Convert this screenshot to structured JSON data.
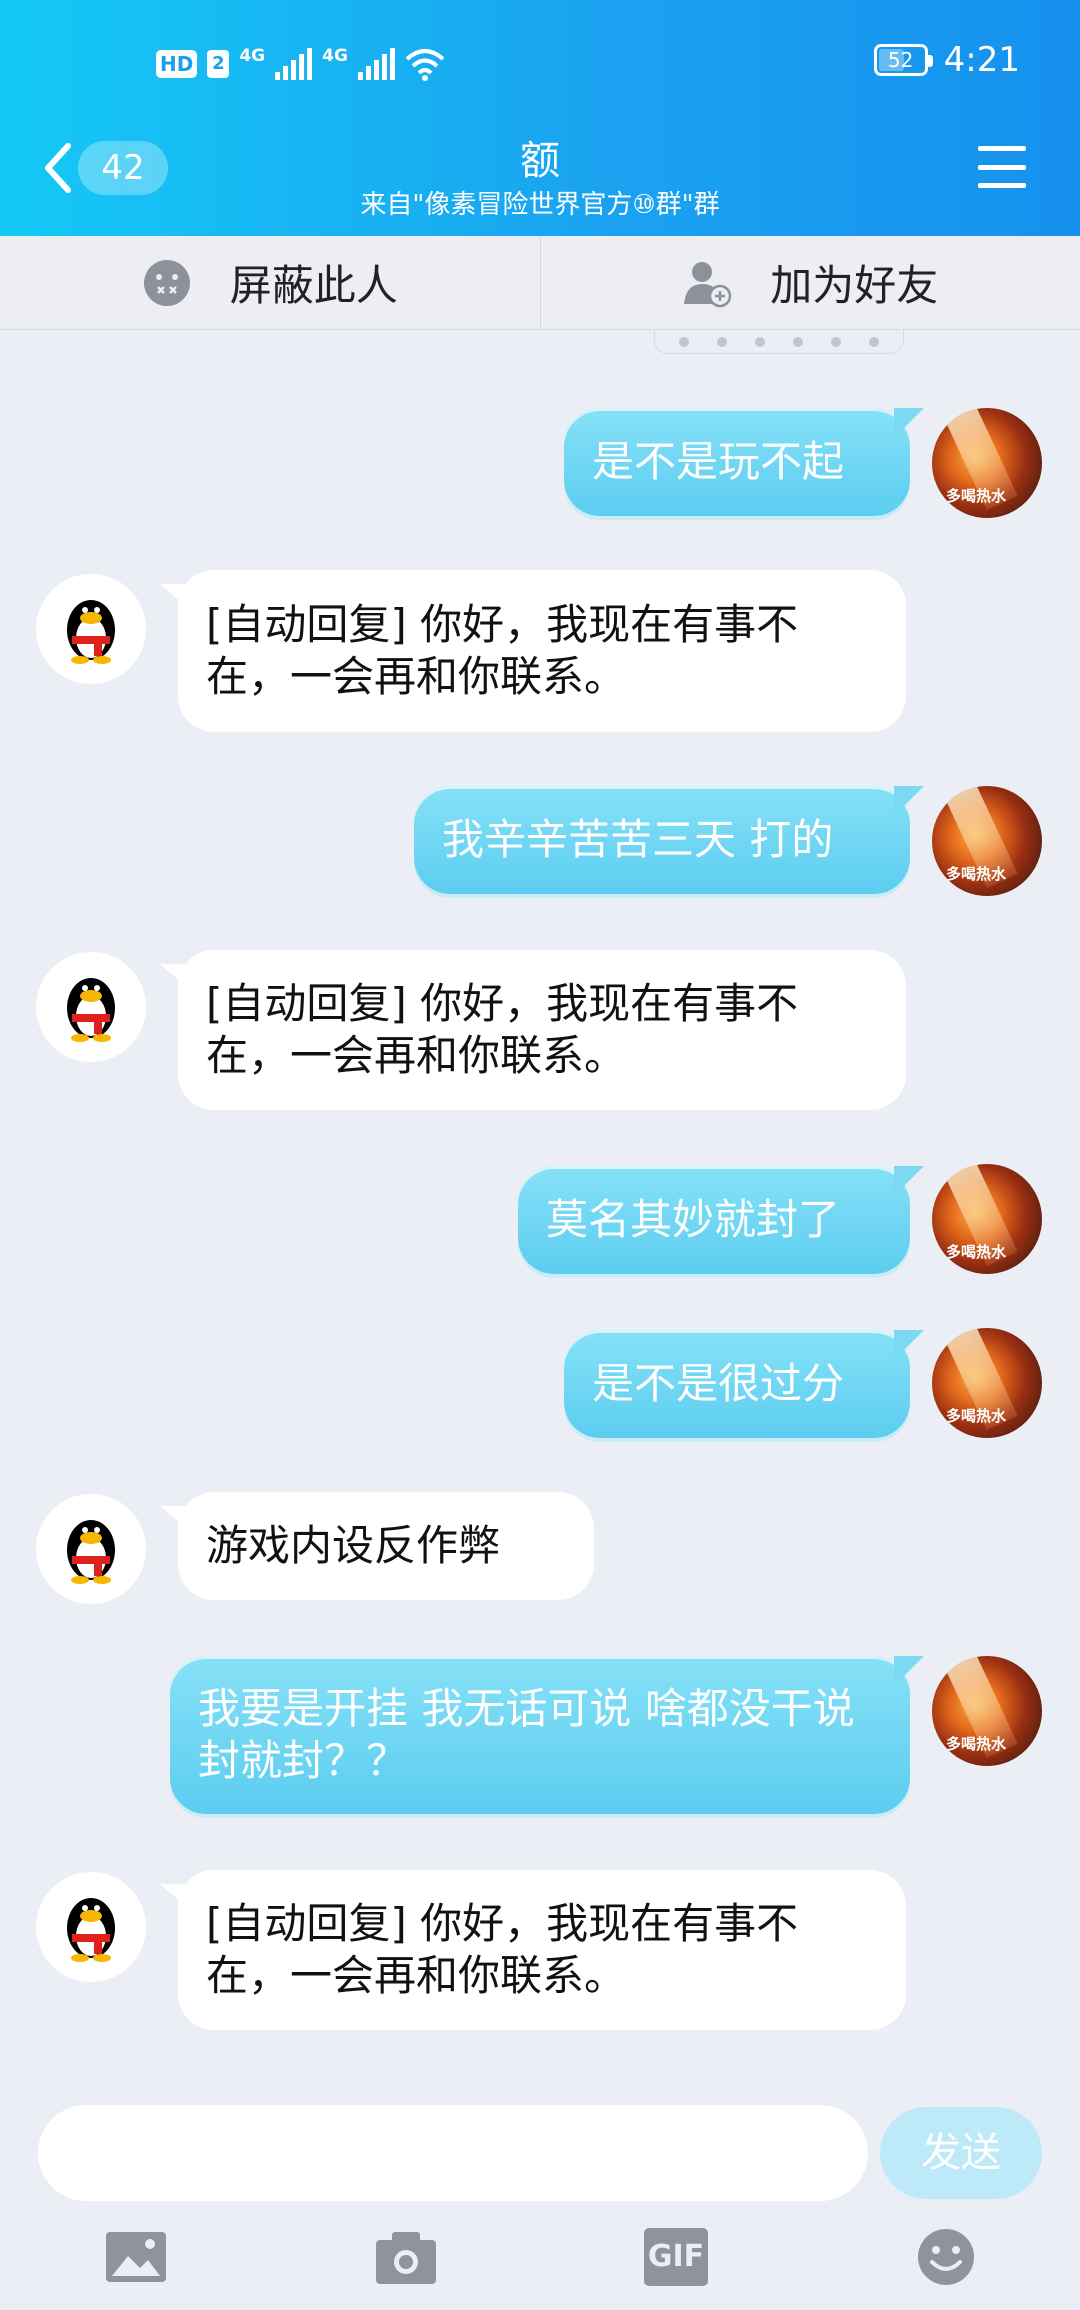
{
  "status_bar": {
    "hd": "HD",
    "sim": "2",
    "net1": "4G",
    "net2": "4G",
    "battery": "52",
    "time": "4:21"
  },
  "header": {
    "unread_count": "42",
    "title": "额",
    "subtitle": "来自\"像素冒险世界官方⑩群\"群"
  },
  "actions": {
    "block_label": "屏蔽此人",
    "add_friend_label": "加为好友"
  },
  "messages": [
    {
      "dir": "out",
      "text": "是不是玩不起",
      "avatar_tag": "多喝热水"
    },
    {
      "dir": "in",
      "text": "[自动回复] 你好，我现在有事不在，一会再和你联系。"
    },
    {
      "dir": "out",
      "text": "我辛辛苦苦三天 打的",
      "avatar_tag": "多喝热水"
    },
    {
      "dir": "in",
      "text": "[自动回复] 你好，我现在有事不在，一会再和你联系。"
    },
    {
      "dir": "out",
      "text": "莫名其妙就封了",
      "avatar_tag": "多喝热水"
    },
    {
      "dir": "out",
      "text": "是不是很过分",
      "avatar_tag": "多喝热水"
    },
    {
      "dir": "in",
      "text": "游戏内设反作弊"
    },
    {
      "dir": "out",
      "text": "我要是开挂  我无话可说  啥都没干说封就封？？",
      "avatar_tag": "多喝热水"
    },
    {
      "dir": "in",
      "text": "[自动回复] 你好，我现在有事不在，一会再和你联系。"
    }
  ],
  "input": {
    "value": "",
    "placeholder": "",
    "send_label": "发送"
  },
  "toolbar": {
    "icons": [
      "image-icon",
      "camera-icon",
      "gif-icon",
      "emoji-icon"
    ],
    "gif_label": "GIF"
  },
  "colors": {
    "header_start": "#14c9f5",
    "header_end": "#1691ee",
    "bubble_out": "#5ccdf0",
    "background": "#eceef5"
  }
}
